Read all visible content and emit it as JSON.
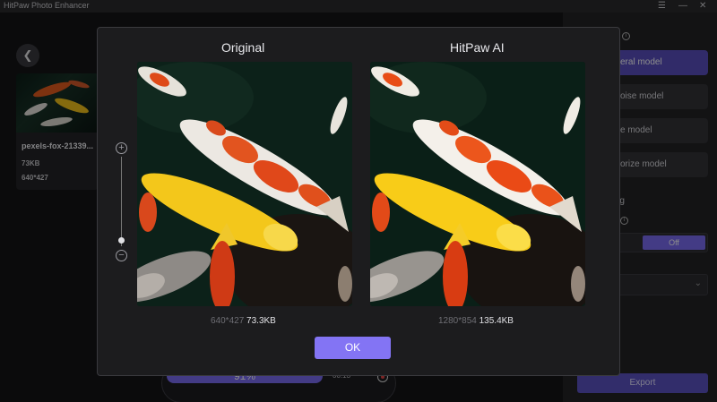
{
  "window": {
    "title": "HitPaw Photo Enhancer",
    "controls": {
      "menu": "☰",
      "minimize": "—",
      "close": "✕"
    }
  },
  "file": {
    "name": "pexels-fox-21339...",
    "size": "73KB",
    "dimensions": "640*427"
  },
  "progress": {
    "label": "91%",
    "value": 0.91,
    "time": "00:13"
  },
  "panel": {
    "models": [
      {
        "label": "eral model",
        "active": true
      },
      {
        "label": "oise model",
        "active": false
      },
      {
        "label": "e model",
        "active": false
      },
      {
        "label": "orize model",
        "active": false
      }
    ],
    "setting_label": "tting",
    "toggle_off": "Off",
    "export_label": "Export"
  },
  "preview": {
    "original": {
      "title": "Original",
      "dims": "640*427",
      "size": "73.3KB"
    },
    "enhanced": {
      "title": "HitPaw AI",
      "dims": "1280*854",
      "size": "135.4KB"
    },
    "ok_label": "OK",
    "zoom": {
      "plus": "+",
      "minus": "−",
      "level": 0.1
    }
  },
  "colors": {
    "accent": "#7a6cf3",
    "ok": "#8374f4",
    "koi_orange": "#e04a1a",
    "koi_yellow": "#f0c419"
  }
}
